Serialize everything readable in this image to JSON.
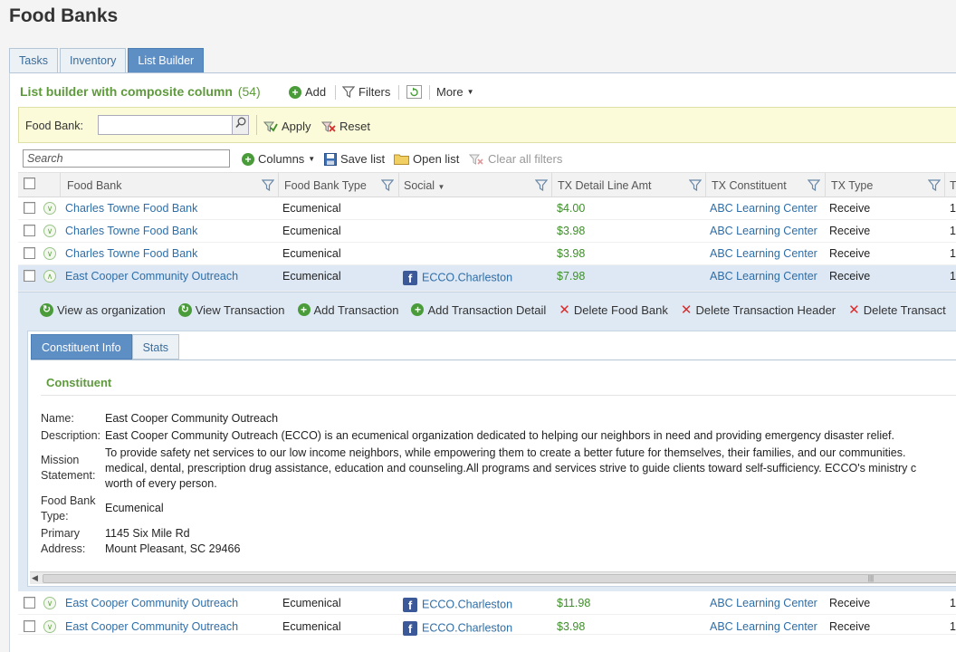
{
  "page": {
    "title": "Food Banks"
  },
  "tabs": [
    {
      "label": "Tasks",
      "active": false
    },
    {
      "label": "Inventory",
      "active": false
    },
    {
      "label": "List Builder",
      "active": true
    }
  ],
  "listbuilder": {
    "title": "List builder with composite column",
    "count": "(54)",
    "add_label": "Add",
    "filters_label": "Filters",
    "more_label": "More"
  },
  "filterbar": {
    "food_bank_label": "Food Bank:",
    "food_bank_value": "",
    "apply_label": "Apply",
    "reset_label": "Reset"
  },
  "toolbar2": {
    "search_placeholder": "Search",
    "columns_label": "Columns",
    "save_list_label": "Save list",
    "open_list_label": "Open list",
    "clear_filters_label": "Clear all filters"
  },
  "grid": {
    "columns": [
      "Food Bank",
      "Food Bank Type",
      "Social",
      "TX Detail Line Amt",
      "TX Constituent",
      "TX Type",
      "T"
    ],
    "rows_top": [
      {
        "food_bank": "Charles Towne Food Bank",
        "type": "Ecumenical",
        "social": "",
        "amount": "$4.00",
        "constituent": "ABC Learning Center",
        "tx_type": "Receive",
        "extra": "1"
      },
      {
        "food_bank": "Charles Towne Food Bank",
        "type": "Ecumenical",
        "social": "",
        "amount": "$3.98",
        "constituent": "ABC Learning Center",
        "tx_type": "Receive",
        "extra": "1"
      },
      {
        "food_bank": "Charles Towne Food Bank",
        "type": "Ecumenical",
        "social": "",
        "amount": "$3.98",
        "constituent": "ABC Learning Center",
        "tx_type": "Receive",
        "extra": "1"
      },
      {
        "food_bank": "East Cooper Community Outreach",
        "type": "Ecumenical",
        "social": "ECCO.Charleston",
        "amount": "$7.98",
        "constituent": "ABC Learning Center",
        "tx_type": "Receive",
        "extra": "1:"
      }
    ],
    "rows_bottom": [
      {
        "food_bank": "East Cooper Community Outreach",
        "type": "Ecumenical",
        "social": "ECCO.Charleston",
        "amount": "$11.98",
        "constituent": "ABC Learning Center",
        "tx_type": "Receive",
        "extra": "1:"
      },
      {
        "food_bank": "East Cooper Community Outreach",
        "type": "Ecumenical",
        "social": "ECCO.Charleston",
        "amount": "$3.98",
        "constituent": "ABC Learning Center",
        "tx_type": "Receive",
        "extra": "1:"
      }
    ]
  },
  "detail": {
    "actions": [
      "View as organization",
      "View Transaction",
      "Add Transaction",
      "Add Transaction Detail",
      "Delete Food Bank",
      "Delete Transaction Header",
      "Delete Transact"
    ],
    "tabs": [
      "Constituent Info",
      "Stats"
    ],
    "section_title": "Constituent",
    "fields": {
      "name_label": "Name:",
      "name_value": "East Cooper Community Outreach",
      "description_label": "Description:",
      "description_value": "East Cooper Community Outreach (ECCO) is an ecumenical organization dedicated to helping our neighbors in need and providing emergency disaster relief.",
      "mission_label_1": "Mission",
      "mission_label_2": "Statement:",
      "mission_line_1": "To provide safety net services to our low income neighbors, while empowering them to create a better future for themselves, their families, and our communities.",
      "mission_line_2": "medical, dental, prescription drug assistance, education and counseling.All programs and services strive to guide clients toward self-sufficiency. ECCO's ministry c",
      "mission_line_3": "worth of every person.",
      "type_label_1": "Food Bank",
      "type_label_2": "Type:",
      "type_value": "Ecumenical",
      "address_label_1": "Primary",
      "address_label_2": "Address:",
      "address_line_1": "1145 Six Mile Rd",
      "address_line_2": "Mount Pleasant, SC  29466"
    }
  },
  "colors": {
    "accent_green": "#5e9a3c",
    "link_blue": "#2e6ea8",
    "tab_active": "#5d8ec4",
    "filter_bg": "#fbfbd9"
  }
}
